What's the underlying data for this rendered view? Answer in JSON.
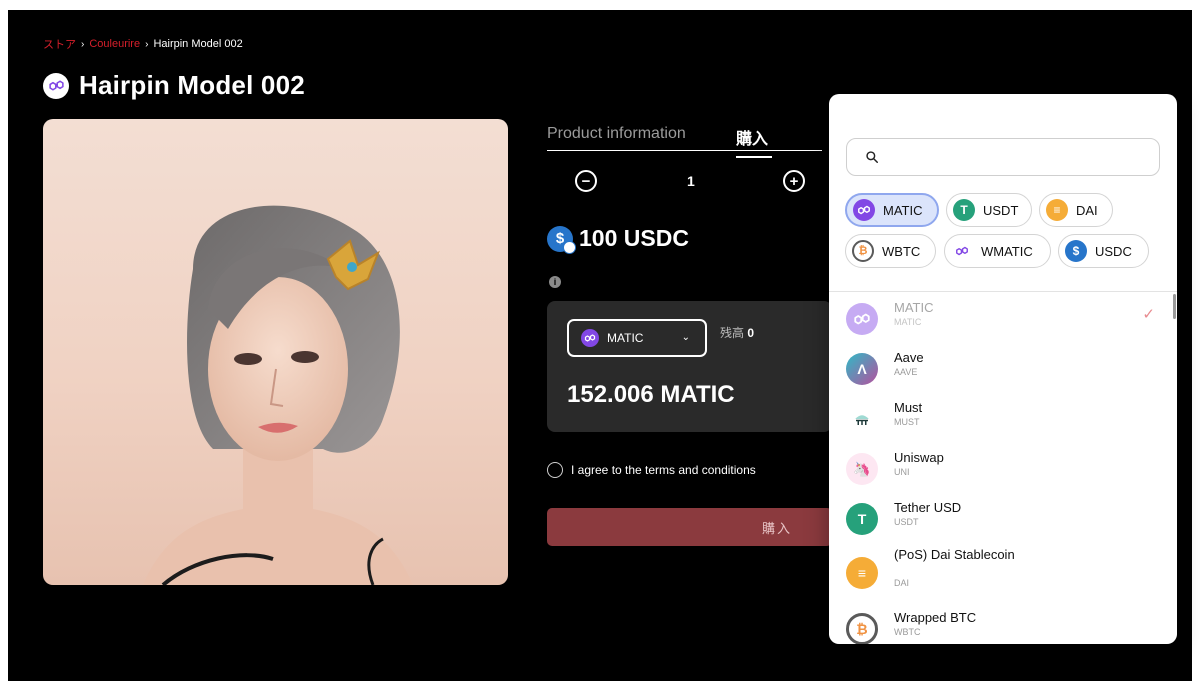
{
  "breadcrumb": {
    "store": "ストア",
    "brand": "Couleurire",
    "current": "Hairpin Model 002",
    "sep": "›"
  },
  "product": {
    "title": "Hairpin Model 002",
    "tab_info": "Product information",
    "tab_buy": "購入",
    "quantity": "1",
    "price": "100 USDC",
    "info_icon": "i"
  },
  "payment": {
    "token": "MATIC",
    "balance_label": "残高",
    "balance_value": "0",
    "amount": "152.006 MATIC",
    "agree_text": "I agree to the terms and conditions",
    "buy_label": "購入"
  },
  "token_picker": {
    "search_placeholder": "",
    "chips": [
      {
        "symbol": "MATIC",
        "color": "#8247e5",
        "selected": true
      },
      {
        "symbol": "USDT",
        "color": "#26a17b",
        "selected": false
      },
      {
        "symbol": "DAI",
        "color": "#f5ac37",
        "selected": false
      },
      {
        "symbol": "WBTC",
        "color": "#f09242",
        "selected": false
      },
      {
        "symbol": "WMATIC",
        "color": "#8247e5",
        "selected": false
      },
      {
        "symbol": "USDC",
        "color": "#2775ca",
        "selected": false
      }
    ],
    "tokens": [
      {
        "name": "MATIC",
        "symbol": "MATIC",
        "selected": true
      },
      {
        "name": "Aave",
        "symbol": "AAVE"
      },
      {
        "name": "Must",
        "symbol": "MUST"
      },
      {
        "name": "Uniswap",
        "symbol": "UNI"
      },
      {
        "name": "Tether USD",
        "symbol": "USDT"
      },
      {
        "name": "(PoS) Dai Stablecoin",
        "symbol": "DAI"
      },
      {
        "name": "Wrapped BTC",
        "symbol": "WBTC"
      }
    ],
    "check": "✓"
  },
  "colors": {
    "accent_red": "#d61f2b",
    "buy_button": "#8b3a3e",
    "polygon": "#8247e5",
    "usdc": "#2775ca"
  }
}
